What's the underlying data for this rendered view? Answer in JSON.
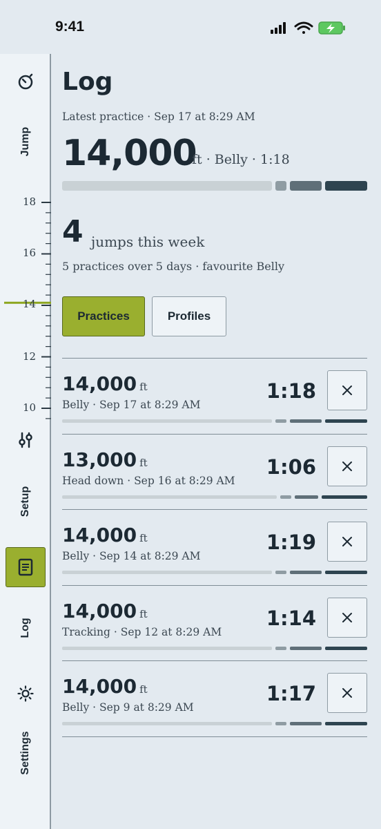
{
  "status_bar": {
    "time": "9:41"
  },
  "sidebar": {
    "items": [
      {
        "label": "Jump",
        "icon": "stopwatch-icon"
      },
      {
        "label": "Setup",
        "icon": "sliders-icon"
      },
      {
        "label": "Log",
        "icon": "document-icon",
        "active": true
      },
      {
        "label": "Settings",
        "icon": "sun-gear-icon"
      }
    ],
    "altitude_ticks": [
      "18",
      "16",
      "14",
      "12",
      "10"
    ],
    "altitude_marker_value": 14.1
  },
  "colors": {
    "accent": "#9aaf2f",
    "accent_border": "#58681c",
    "bar_light": "#c9d1d5",
    "bar_mid": "#8f9ca3",
    "bar_dark_mid": "#5f6f78",
    "bar_dark": "#2e4450",
    "marker": "#8ca51e"
  },
  "header": {
    "title": "Log",
    "latest_practice": "Latest practice · Sep 17 at 8:29 AM",
    "altitude": "14,000",
    "meta": "ft · Belly · 1:18"
  },
  "week": {
    "count": "4",
    "label": "jumps this week",
    "summary": "5 practices over 5 days · favourite Belly"
  },
  "tabs": [
    {
      "label": "Practices",
      "active": true
    },
    {
      "label": "Profiles",
      "active": false
    }
  ],
  "unit": "ft",
  "practices": [
    {
      "altitude": "14,000",
      "subtitle": "Belly · Sep 17 at 8:29 AM",
      "duration": "1:18"
    },
    {
      "altitude": "13,000",
      "subtitle": "Head down · Sep 16 at 8:29 AM",
      "duration": "1:06"
    },
    {
      "altitude": "14,000",
      "subtitle": "Belly · Sep 14 at 8:29 AM",
      "duration": "1:19"
    },
    {
      "altitude": "14,000",
      "subtitle": "Tracking · Sep 12 at 8:29 AM",
      "duration": "1:14"
    },
    {
      "altitude": "14,000",
      "subtitle": "Belly · Sep 9 at 8:29 AM",
      "duration": "1:17"
    }
  ]
}
